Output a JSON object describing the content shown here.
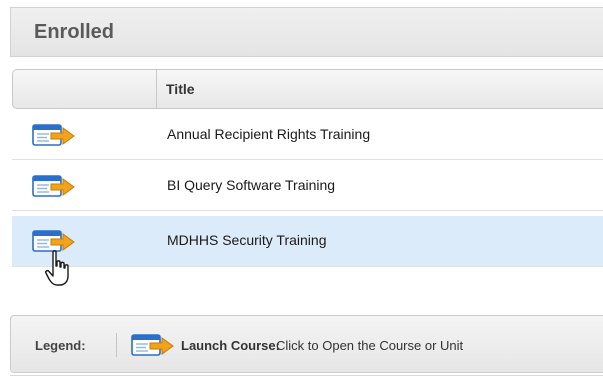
{
  "panel": {
    "title": "Enrolled"
  },
  "grid": {
    "columns": [
      "",
      "Title"
    ],
    "rows": [
      {
        "icon": "launch-course-icon",
        "title": "Annual Recipient Rights Training",
        "selected": false
      },
      {
        "icon": "launch-course-icon",
        "title": "BI Query Software Training",
        "selected": false
      },
      {
        "icon": "launch-course-icon",
        "title": "MDHHS Security Training",
        "selected": true
      }
    ]
  },
  "legend": {
    "label": "Legend:",
    "items": [
      {
        "icon": "launch-course-icon",
        "name": "Launch Course:",
        "description": "Click to Open the Course or Unit"
      }
    ]
  },
  "cursor": {
    "icon": "hand-pointer-icon"
  },
  "colors": {
    "selected_row": "#dcebfa",
    "icon_window_blue": "#2a6fc9",
    "icon_arrow_orange": "#f2a31b"
  }
}
